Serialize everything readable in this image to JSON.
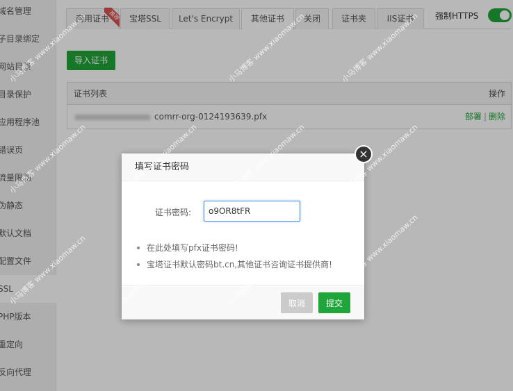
{
  "sidebar": {
    "items": [
      {
        "label": "域名管理"
      },
      {
        "label": "子目录绑定"
      },
      {
        "label": "网站目录"
      },
      {
        "label": "目录保护"
      },
      {
        "label": "应用程序池"
      },
      {
        "label": "错误页"
      },
      {
        "label": "流量限制"
      },
      {
        "label": "伪静态"
      },
      {
        "label": "默认文档"
      },
      {
        "label": "配置文件"
      },
      {
        "label": "SSL"
      },
      {
        "label": "PHP版本"
      },
      {
        "label": "重定向"
      },
      {
        "label": "反向代理"
      }
    ]
  },
  "tabs": [
    {
      "label": "商用证书",
      "badge": "推荐"
    },
    {
      "label": "宝塔SSL"
    },
    {
      "label": "Let's Encrypt"
    },
    {
      "label": "其他证书"
    },
    {
      "label": "关闭"
    },
    {
      "label": "证书夹"
    },
    {
      "label": "IIS证书"
    }
  ],
  "https_toggle": {
    "label": "强制HTTPS",
    "on": true
  },
  "import_button": "导入证书",
  "cert_table": {
    "header_name": "证书列表",
    "header_ops": "操作",
    "rows": [
      {
        "filename": "comrr-org-0124193639.pfx",
        "op_deploy": "部署",
        "op_sep": "|",
        "op_delete": "删除"
      }
    ]
  },
  "modal": {
    "title": "填写证书密码",
    "close_glyph": "×",
    "label": "证书密码:",
    "password_value": "o9OR8tFR",
    "tips": [
      "在此处填写pfx证书密码!",
      "宝塔证书默认密码bt.cn,其他证书咨询证书提供商!"
    ],
    "cancel": "取消",
    "submit": "提交"
  },
  "watermark": "小马博客 www.xiaomaw.cn",
  "colors": {
    "accent": "#20a53a",
    "ribbon": "#d9534f"
  }
}
